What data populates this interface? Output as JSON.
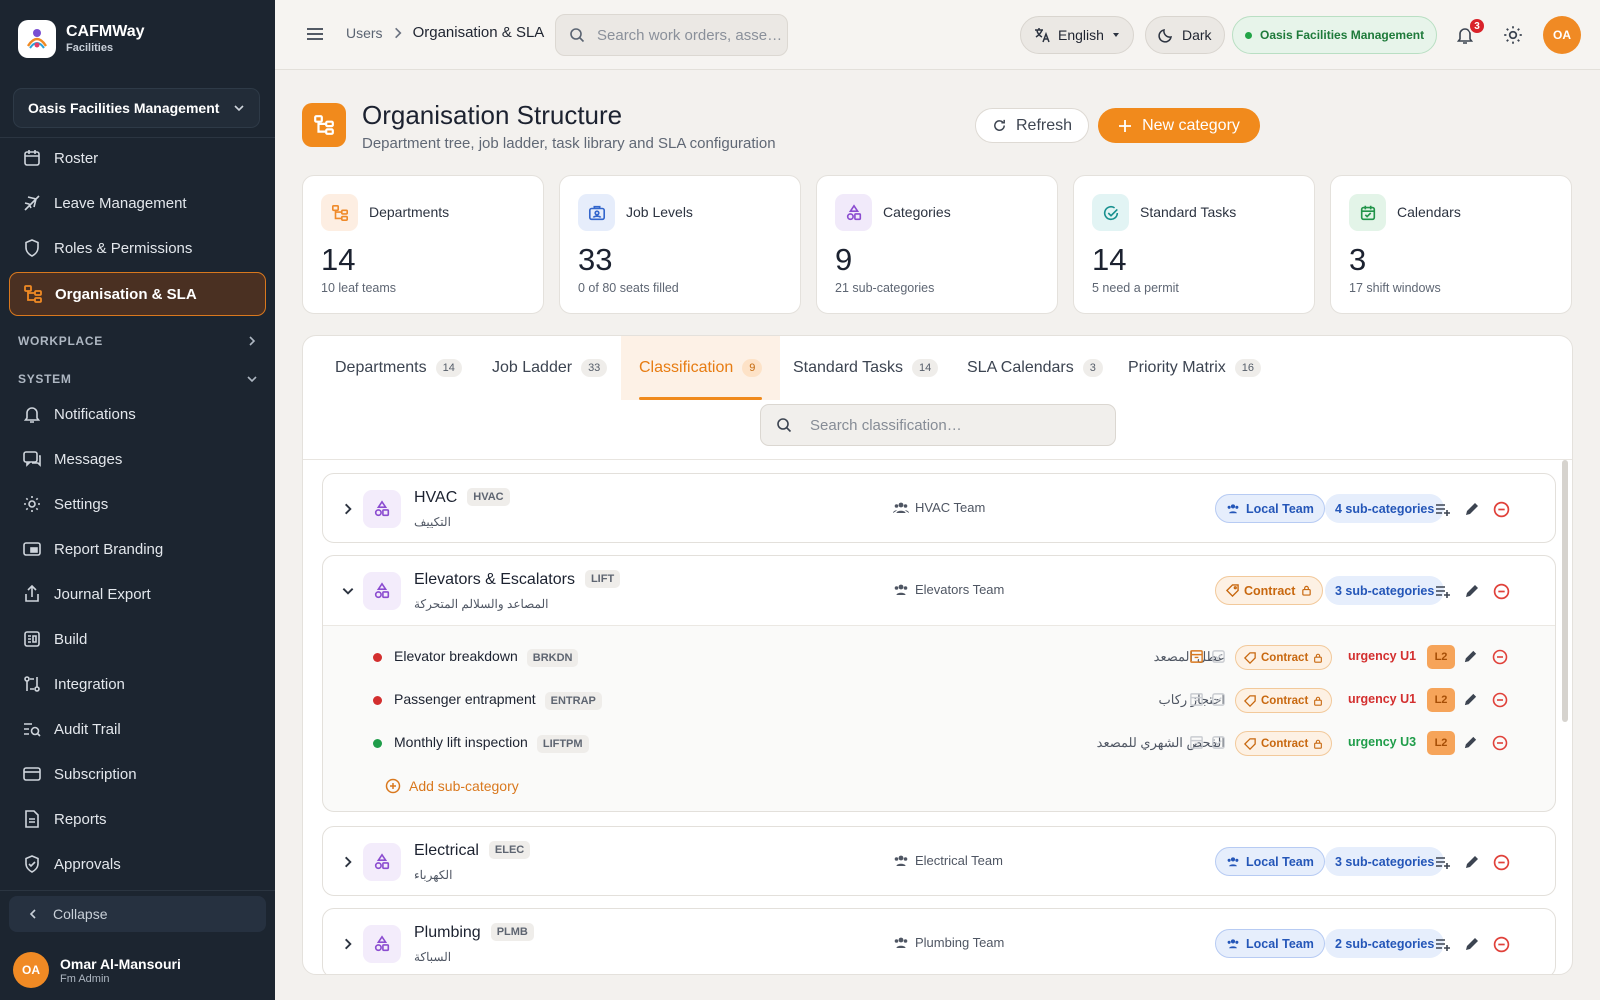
{
  "app": {
    "name": "CAFMWay",
    "subtitle": "Facilities"
  },
  "sidebar": {
    "org_selector": "Oasis Facilities Management",
    "items_top": [
      {
        "label": "Roster",
        "icon": "calendar-icon"
      },
      {
        "label": "Leave Management",
        "icon": "plane-icon"
      },
      {
        "label": "Roles & Permissions",
        "icon": "shield-icon"
      },
      {
        "label": "Organisation & SLA",
        "icon": "org-tree-icon",
        "active": true
      }
    ],
    "groups": {
      "workplace": "WORKPLACE",
      "system": "SYSTEM"
    },
    "items_system": [
      {
        "label": "Notifications",
        "icon": "bell-icon"
      },
      {
        "label": "Messages",
        "icon": "chat-icon"
      },
      {
        "label": "Settings",
        "icon": "gear-icon"
      },
      {
        "label": "Report Branding",
        "icon": "branding-icon"
      },
      {
        "label": "Journal Export",
        "icon": "export-icon"
      },
      {
        "label": "Build",
        "icon": "build-icon"
      },
      {
        "label": "Integration",
        "icon": "integration-icon"
      },
      {
        "label": "Audit Trail",
        "icon": "audit-icon"
      },
      {
        "label": "Subscription",
        "icon": "card-icon"
      },
      {
        "label": "Reports",
        "icon": "report-icon"
      },
      {
        "label": "Approvals",
        "icon": "approval-icon"
      }
    ],
    "collapse": "Collapse",
    "user": {
      "initials": "OA",
      "name": "Omar Al-Mansouri",
      "role": "Fm Admin"
    }
  },
  "topbar": {
    "breadcrumb": [
      "Users",
      "Organisation & SLA"
    ],
    "search_placeholder": "Search work orders, asse…",
    "language": "English",
    "theme": "Dark",
    "org": "Oasis Facilities Management",
    "notifications": "3",
    "avatar": "OA"
  },
  "colors": {
    "accent": "#f18a1c",
    "sidebar": "#1c2530",
    "urgent": "#d32f2f",
    "ok": "#1f9d4a"
  },
  "page": {
    "title": "Organisation Structure",
    "subtitle": "Department tree, job ladder, task library and SLA configuration",
    "refresh": "Refresh",
    "new_category": "New category"
  },
  "stats": [
    {
      "label": "Departments",
      "value": "14",
      "sub": "10 leaf teams"
    },
    {
      "label": "Job Levels",
      "value": "33",
      "sub": "0 of 80 seats filled"
    },
    {
      "label": "Categories",
      "value": "9",
      "sub": "21 sub-categories"
    },
    {
      "label": "Standard Tasks",
      "value": "14",
      "sub": "5 need a permit"
    },
    {
      "label": "Calendars",
      "value": "3",
      "sub": "17 shift windows"
    }
  ],
  "tabs": [
    {
      "label": "Departments",
      "count": "14"
    },
    {
      "label": "Job Ladder",
      "count": "33"
    },
    {
      "label": "Classification",
      "count": "9",
      "active": true
    },
    {
      "label": "Standard Tasks",
      "count": "14"
    },
    {
      "label": "SLA Calendars",
      "count": "3"
    },
    {
      "label": "Priority Matrix",
      "count": "16"
    }
  ],
  "classification": {
    "search_placeholder": "Search classification…",
    "add_sub": "Add sub-category",
    "categories": [
      {
        "name": "HVAC",
        "code": "HVAC",
        "arabic": "التكييف",
        "team": "HVAC Team",
        "mode": "Local Team",
        "subs": "4 sub-categories",
        "expanded": false
      },
      {
        "name": "Elevators & Escalators",
        "code": "LIFT",
        "arabic": "المصاعد والسلالم المتحركة",
        "team": "Elevators Team",
        "mode": "Contract",
        "subs": "3 sub-categories",
        "expanded": true,
        "children": [
          {
            "name": "Elevator breakdown",
            "code": "BRKDN",
            "arabic": "عطل المصعد",
            "mode": "Contract",
            "urgency": "urgency U1",
            "level": "L2",
            "status": "urgent"
          },
          {
            "name": "Passenger entrapment",
            "code": "ENTRAP",
            "arabic": "احتجاز ركاب",
            "mode": "Contract",
            "urgency": "urgency U1",
            "level": "L2",
            "status": "urgent"
          },
          {
            "name": "Monthly lift inspection",
            "code": "LIFTPM",
            "arabic": "الفحص الشهري للمصعد",
            "mode": "Contract",
            "urgency": "urgency U3",
            "level": "L2",
            "status": "ok"
          }
        ]
      },
      {
        "name": "Electrical",
        "code": "ELEC",
        "arabic": "الكهرباء",
        "team": "Electrical Team",
        "mode": "Local Team",
        "subs": "3 sub-categories",
        "expanded": false
      },
      {
        "name": "Plumbing",
        "code": "PLMB",
        "arabic": "السباكة",
        "team": "Plumbing Team",
        "mode": "Local Team",
        "subs": "2 sub-categories",
        "expanded": false
      }
    ]
  }
}
